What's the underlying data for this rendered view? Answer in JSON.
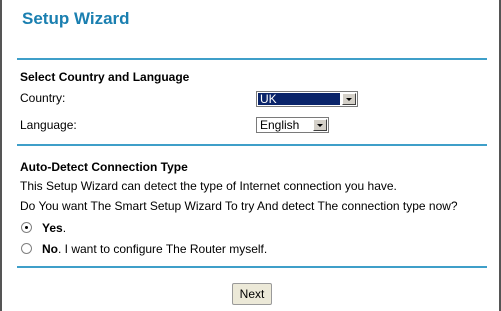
{
  "header": {
    "title": "Setup Wizard"
  },
  "country_language": {
    "section_title": "Select Country and Language",
    "country_label": "Country:",
    "country_value": "UK",
    "language_label": "Language:",
    "language_value": "English"
  },
  "auto_detect": {
    "section_title": "Auto-Detect Connection Type",
    "description": "This Setup Wizard can detect the type of Internet connection you have.",
    "question": "Do You want The Smart Setup Wizard To try And detect The connection type now?",
    "option_yes_bold": "Yes",
    "option_yes_rest": ".",
    "option_no_bold": "No",
    "option_no_rest": ". I want to configure The Router myself.",
    "selected": "yes"
  },
  "actions": {
    "next_label": "Next"
  }
}
